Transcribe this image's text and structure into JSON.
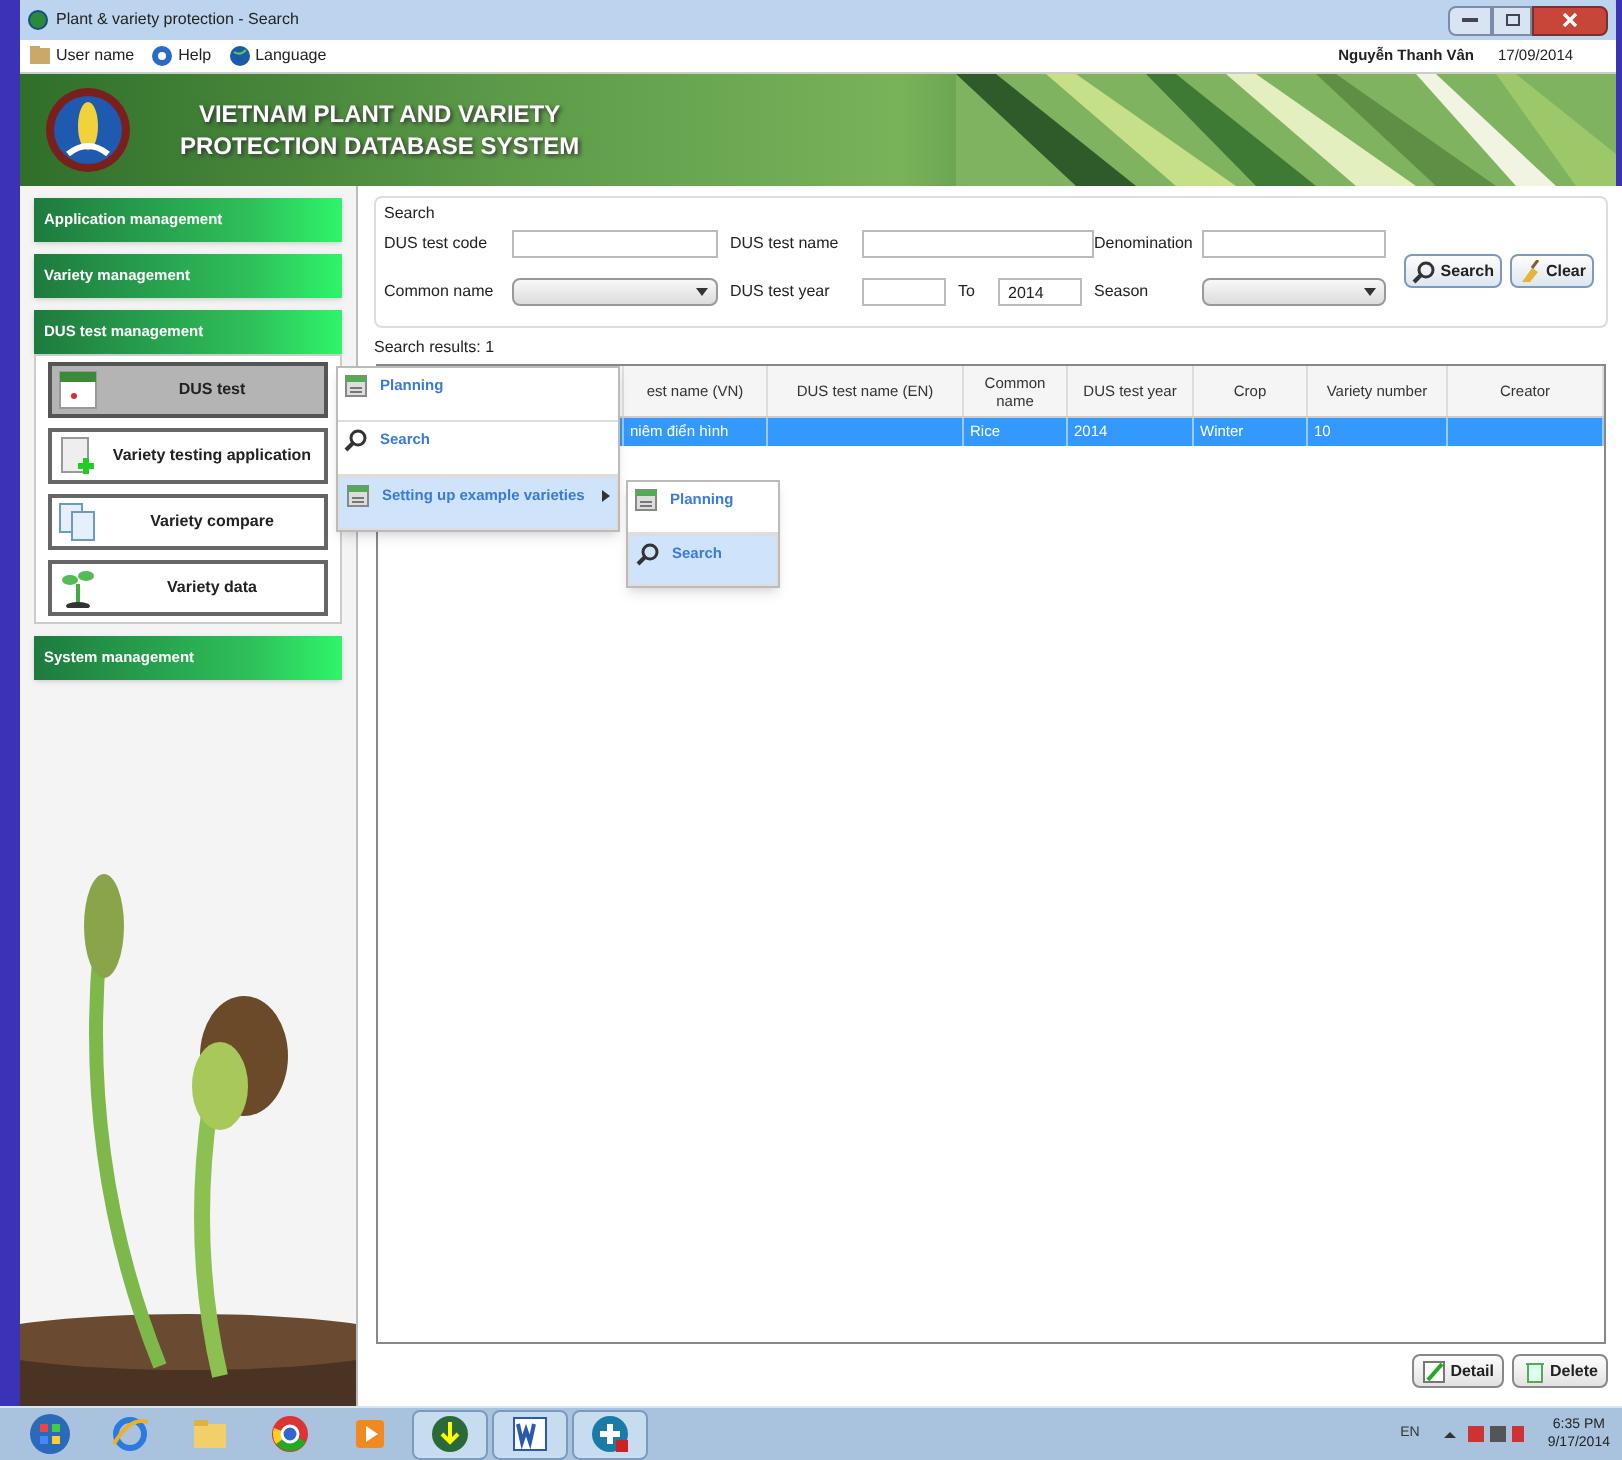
{
  "window": {
    "title": "Plant & variety protection - Search"
  },
  "menu_bar": {
    "items": [
      {
        "label": "User name",
        "kind": "user"
      },
      {
        "label": "Help",
        "kind": "help"
      },
      {
        "label": "Language",
        "kind": "globe"
      }
    ],
    "user": "Nguyễn Thanh Vân",
    "date": "17/09/2014"
  },
  "banner": {
    "title_line_1": "VIETNAM PLANT AND VARIETY",
    "title_line_2": "PROTECTION DATABASE SYSTEM"
  },
  "sidebar": {
    "groups": [
      {
        "label": "Application management"
      },
      {
        "label": "Variety management"
      },
      {
        "label": "DUS test management",
        "items": [
          {
            "label": "DUS test",
            "kind": "calendar",
            "selected": true
          },
          {
            "label": "Variety testing application",
            "kind": "doc-add",
            "selected": false
          },
          {
            "label": "Variety compare",
            "kind": "docs",
            "selected": false
          },
          {
            "label": "Variety data",
            "kind": "plant",
            "selected": false
          }
        ]
      },
      {
        "label": "System management"
      }
    ]
  },
  "search": {
    "title": "Search",
    "fields": [
      {
        "label": "DUS test code",
        "kind": "text"
      },
      {
        "label": "DUS test name",
        "kind": "text"
      },
      {
        "label": "Denomination",
        "kind": "text"
      },
      {
        "label": "Common name",
        "kind": "combo"
      },
      {
        "label": "DUS test year",
        "kind": "year"
      },
      {
        "label": "To",
        "kind": "year",
        "value": "2014"
      },
      {
        "label": "Season",
        "kind": "combo"
      }
    ],
    "buttons": [
      {
        "label": "Search",
        "kind": "search"
      },
      {
        "label": "Clear",
        "kind": "clear"
      }
    ]
  },
  "results": {
    "title": "Search results: 1",
    "columns": [
      "",
      "est name (VN)",
      "DUS test name (EN)",
      "Common name",
      "DUS test year",
      "Crop",
      "Variety number",
      "Creator"
    ],
    "rows": [
      {
        "cells": [
          "",
          "niêm điển hình",
          "",
          "Rice",
          "2014",
          "Winter",
          "10",
          ""
        ],
        "selected": true
      }
    ]
  },
  "context_menu": {
    "items": [
      {
        "label": "Planning",
        "kind": "planning",
        "selected": false,
        "submenu": false
      },
      {
        "label": "Search",
        "kind": "search",
        "selected": false,
        "submenu": false
      },
      {
        "label": "Setting up example varieties",
        "kind": "planning",
        "selected": true,
        "submenu": true
      }
    ],
    "submenu": [
      {
        "label": "Planning",
        "kind": "planning",
        "selected": false
      },
      {
        "label": "Search",
        "kind": "search",
        "selected": true
      }
    ]
  },
  "footer_buttons": [
    {
      "label": "Detail",
      "kind": "edit"
    },
    {
      "label": "Delete",
      "kind": "delete"
    }
  ],
  "taskbar": {
    "apps": [
      {
        "kind": "start",
        "selected": false
      },
      {
        "kind": "ie",
        "selected": false
      },
      {
        "kind": "folder",
        "selected": false
      },
      {
        "kind": "chrome",
        "selected": false
      },
      {
        "kind": "media",
        "selected": false
      },
      {
        "kind": "download",
        "selected": true
      },
      {
        "kind": "word",
        "selected": true
      },
      {
        "kind": "plus",
        "selected": true
      }
    ],
    "language": "EN",
    "time": "6:35 PM",
    "date": "9/17/2014"
  }
}
